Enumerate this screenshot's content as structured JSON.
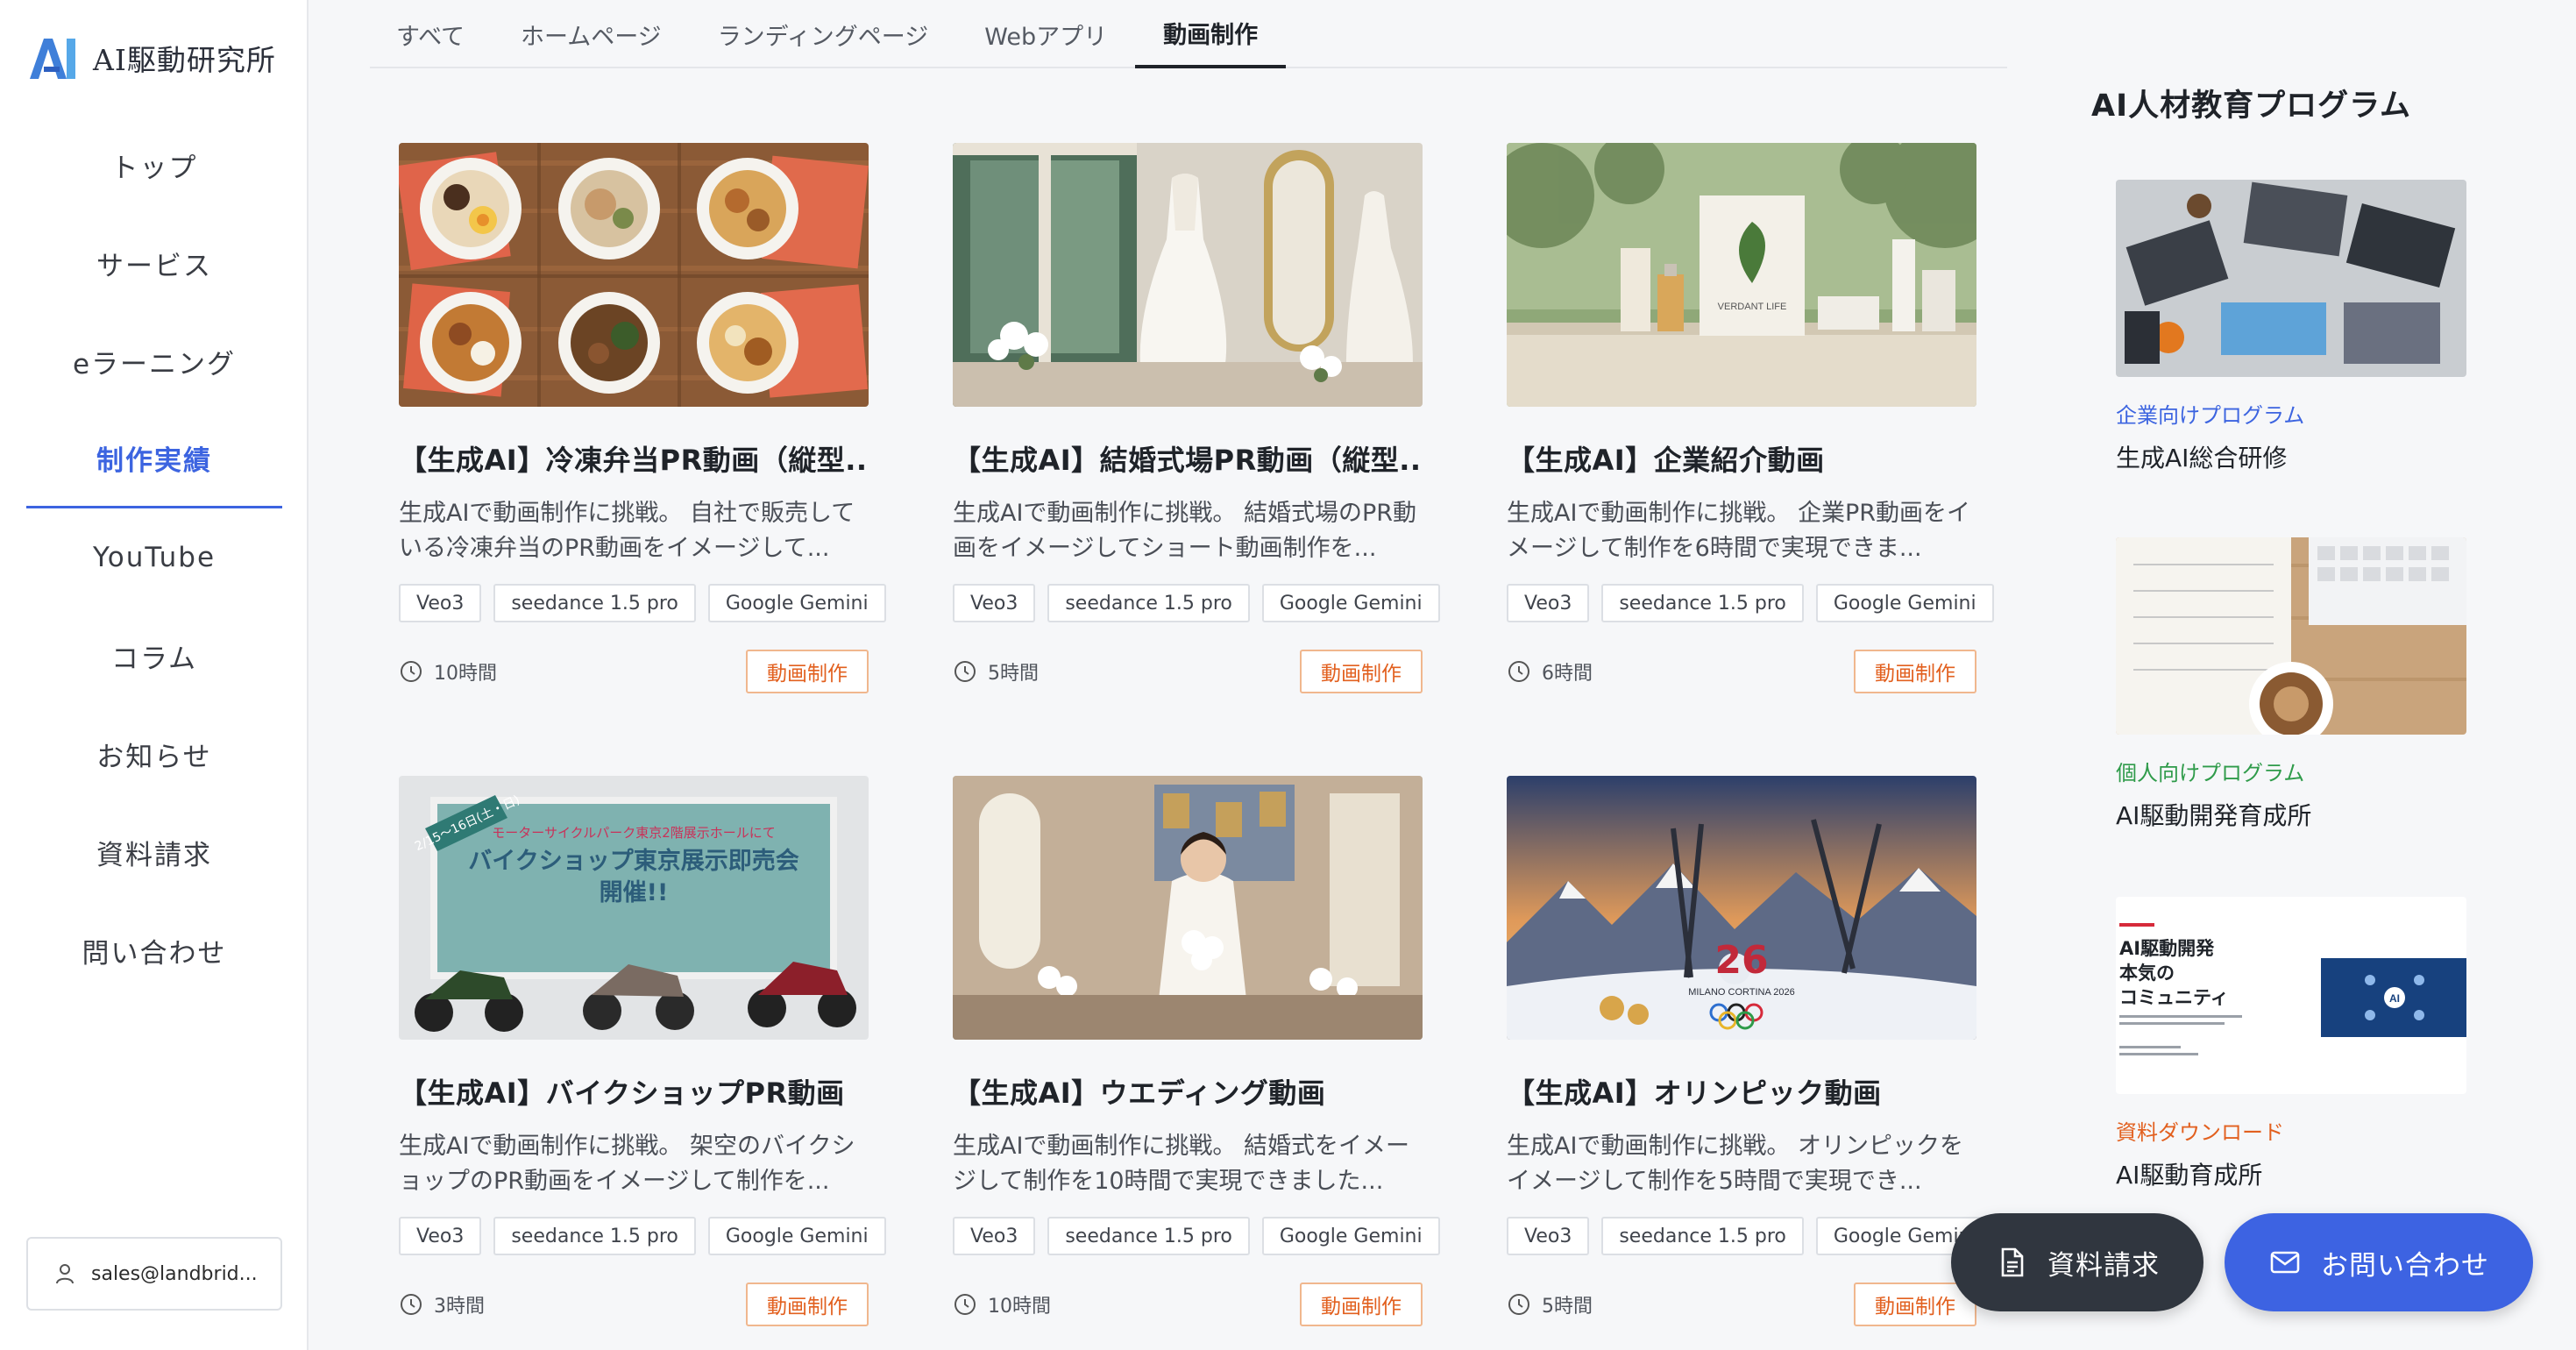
{
  "brand": {
    "name": "AI駆動研究所"
  },
  "sidebar": {
    "items": [
      {
        "label": "トップ"
      },
      {
        "label": "サービス"
      },
      {
        "label": "eラーニング"
      },
      {
        "label": "制作実績",
        "active": true
      },
      {
        "label": "YouTube"
      },
      {
        "label": "コラム"
      },
      {
        "label": "お知らせ"
      },
      {
        "label": "資料請求"
      },
      {
        "label": "問い合わせ"
      }
    ],
    "user_email": "sales@landbrid..."
  },
  "tabs": [
    {
      "label": "すべて"
    },
    {
      "label": "ホームページ"
    },
    {
      "label": "ランディングページ"
    },
    {
      "label": "Webアプリ"
    },
    {
      "label": "動画制作",
      "active": true
    }
  ],
  "cards": [
    {
      "title": "【生成AI】冷凍弁当PR動画（縦型...",
      "desc": "生成AIで動画制作に挑戦。 自社で販売している冷凍弁当のPR動画をイメージして...",
      "tags": [
        "Veo3",
        "seedance 1.5 pro",
        "Google Gemini"
      ],
      "duration": "10時間",
      "category": "動画制作",
      "thumb": "bento-thumbnail"
    },
    {
      "title": "【生成AI】結婚式場PR動画（縦型...",
      "desc": "生成AIで動画制作に挑戦。 結婚式場のPR動画をイメージしてショート動画制作を...",
      "tags": [
        "Veo3",
        "seedance 1.5 pro",
        "Google Gemini"
      ],
      "duration": "5時間",
      "category": "動画制作",
      "thumb": "wedding-dress-thumbnail"
    },
    {
      "title": "【生成AI】企業紹介動画",
      "desc": "生成AIで動画制作に挑戦。 企業PR動画をイメージして制作を6時間で実現できま...",
      "tags": [
        "Veo3",
        "seedance 1.5 pro",
        "Google Gemini"
      ],
      "duration": "6時間",
      "category": "動画制作",
      "thumb": "cosmetics-thumbnail",
      "product_text": "VERDANT LIFE"
    },
    {
      "title": "【生成AI】バイクショップPR動画",
      "desc": "生成AIで動画制作に挑戦。 架空のバイクショップのPR動画をイメージして制作を...",
      "tags": [
        "Veo3",
        "seedance 1.5 pro",
        "Google Gemini"
      ],
      "duration": "3時間",
      "category": "動画制作",
      "thumb": "bike-shop-thumbnail",
      "poster": {
        "date": "2/15〜16日(土・日)",
        "subtitle": "モーターサイクルパーク東京2階展示ホールにて",
        "line1": "バイクショップ東京展示即売会",
        "line2": "開催!!"
      }
    },
    {
      "title": "【生成AI】ウエディング動画",
      "desc": "生成AIで動画制作に挑戦。 結婚式をイメージして制作を10時間で実現できました...",
      "tags": [
        "Veo3",
        "seedance 1.5 pro",
        "Google Gemini"
      ],
      "duration": "10時間",
      "category": "動画制作",
      "thumb": "bride-thumbnail"
    },
    {
      "title": "【生成AI】オリンピック動画",
      "desc": "生成AIで動画制作に挑戦。 オリンピックをイメージして制作を5時間で実現でき...",
      "tags": [
        "Veo3",
        "seedance 1.5 pro",
        "Google Gemini"
      ],
      "duration": "5時間",
      "category": "動画制作",
      "thumb": "olympic-thumbnail",
      "logo_text": "MILANO CORTINA 2026"
    }
  ],
  "right": {
    "heading": "AI人材教育プログラム",
    "promos": [
      {
        "category": "企業向けプログラム",
        "title": "生成AI総合研修",
        "category_color": "#3c64e0",
        "thumb": "laptops-desk-image"
      },
      {
        "category": "個人向けプログラム",
        "title": "AI駆動開発育成所",
        "category_color": "#2f9b4a",
        "thumb": "notebook-coffee-image"
      },
      {
        "category": "資料ダウンロード",
        "title": "AI駆動育成所",
        "category_color": "#e2601f",
        "thumb": "community-brochure-image",
        "brochure": {
          "line1": "AI駆動開発",
          "line2": "本気の",
          "line3": "コミュニティ"
        }
      }
    ]
  },
  "fab": {
    "doc_label": "資料請求",
    "contact_label": "お問い合わせ"
  },
  "colors": {
    "accent": "#3c64e0",
    "badge": "#e2601f",
    "dark_button": "#30363f"
  }
}
